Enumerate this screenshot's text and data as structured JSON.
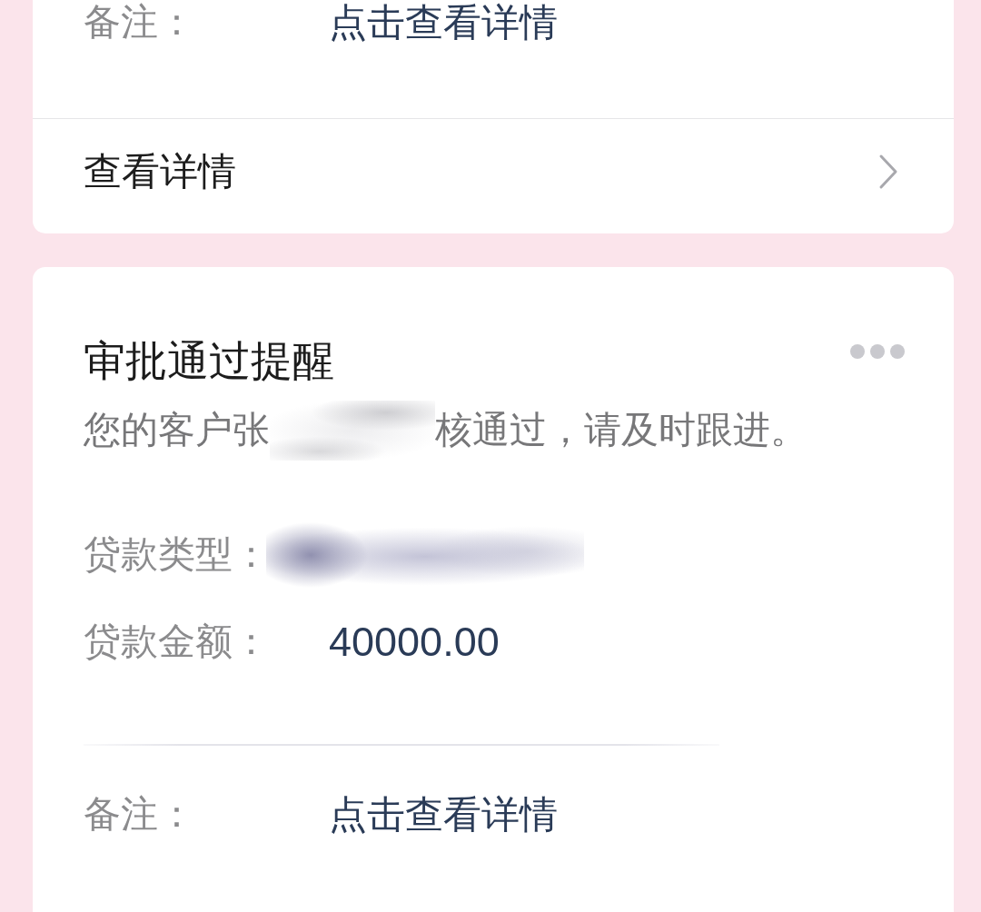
{
  "cards": [
    {
      "fields": [
        {
          "kind": "link",
          "label": "备注：",
          "value": "点击查看详情"
        },
        {
          "kind": "divider"
        }
      ],
      "action": {
        "label": "查看详情"
      }
    },
    {
      "title": "审批通过提醒",
      "message": [
        {
          "kind": "text",
          "text": "您的客户张"
        },
        {
          "kind": "redacted"
        },
        {
          "kind": "text",
          "text": "核通过，请及时跟进。"
        }
      ],
      "fields": [
        {
          "kind": "redacted",
          "label": "贷款类型："
        },
        {
          "kind": "text",
          "label": "贷款金额：",
          "value": "40000.00"
        },
        {
          "kind": "divider"
        },
        {
          "kind": "link",
          "label": "备注：",
          "value": "点击查看详情"
        }
      ]
    }
  ]
}
